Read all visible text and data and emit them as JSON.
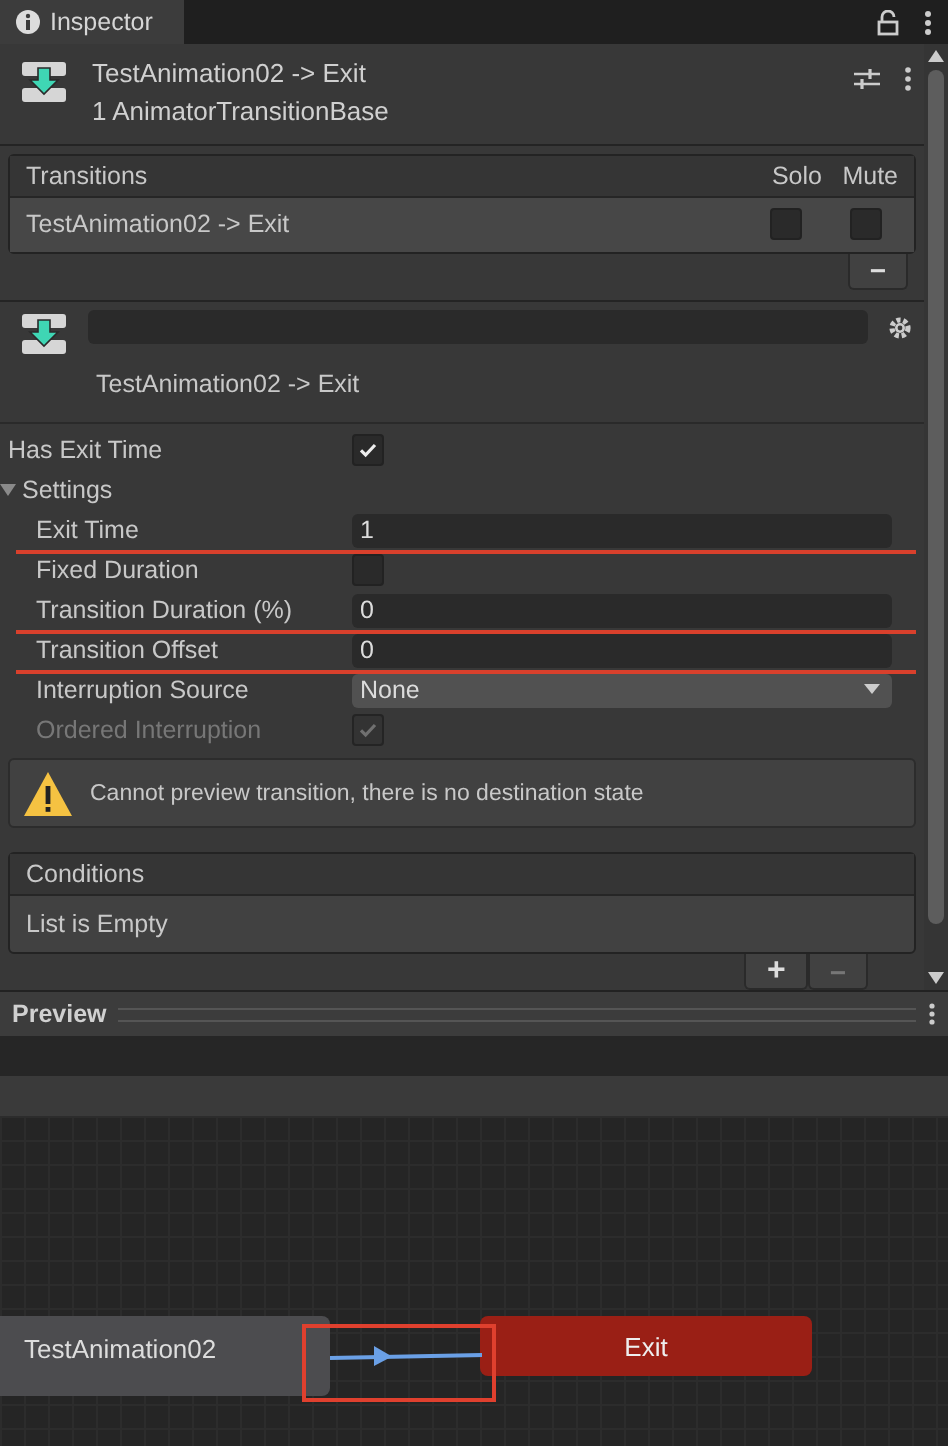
{
  "tab": {
    "title": "Inspector"
  },
  "header": {
    "title": "TestAnimation02 -> Exit",
    "subtitle": "1 AnimatorTransitionBase"
  },
  "transitions": {
    "title": "Transitions",
    "columns": [
      "Solo",
      "Mute"
    ],
    "remove": "−",
    "rows": [
      {
        "name": "TestAnimation02 -> Exit",
        "solo": false,
        "mute": false,
        "selected": true
      }
    ]
  },
  "transition": {
    "label": "TestAnimation02 -> Exit"
  },
  "fields": [
    {
      "kind": "checkbox",
      "label": "Has Exit Time",
      "checked": true
    },
    {
      "kind": "foldout",
      "label": "Settings",
      "expanded": true,
      "children": [
        {
          "kind": "number",
          "label": "Exit Time",
          "value": "1",
          "marked": true
        },
        {
          "kind": "checkbox",
          "label": "Fixed Duration",
          "checked": false
        },
        {
          "kind": "number",
          "label": "Transition Duration (%)",
          "value": "0",
          "marked": true
        },
        {
          "kind": "number",
          "label": "Transition Offset",
          "value": "0",
          "marked": true
        },
        {
          "kind": "dropdown",
          "label": "Interruption Source",
          "value": "None"
        },
        {
          "kind": "checkbox",
          "label": "Ordered Interruption",
          "checked": true,
          "disabled": true
        }
      ]
    }
  ],
  "warning": {
    "message": "Cannot preview transition, there is no destination state"
  },
  "conditions": {
    "title": "Conditions",
    "empty_text": "List is Empty",
    "add": "+",
    "remove": "−"
  },
  "preview": {
    "title": "Preview"
  },
  "graph": {
    "states": [
      {
        "kind": "state",
        "label": "TestAnimation02"
      },
      {
        "kind": "exit",
        "label": "Exit"
      }
    ],
    "transition_highlighted": true
  }
}
